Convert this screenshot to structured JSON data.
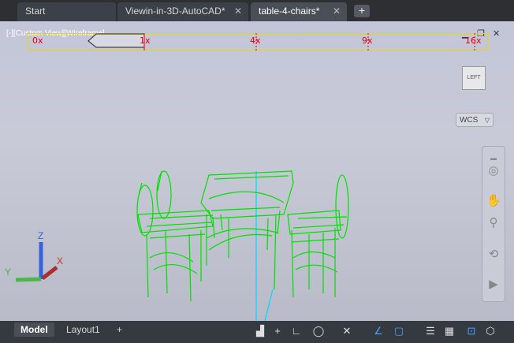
{
  "tabs": [
    {
      "label": "Start"
    },
    {
      "label": "Viewin-in-3D-AutoCAD*"
    },
    {
      "label": "table-4-chairs*"
    }
  ],
  "viewport": {
    "view_label": "[-][Custom View][Wireframe]",
    "wcs_label": "WCS",
    "viewcube_label": "LEFT"
  },
  "zoom_scale": {
    "labels": [
      "0x",
      "1x",
      "4x",
      "9x",
      "16x"
    ]
  },
  "layout_tabs": [
    {
      "label": "Model"
    },
    {
      "label": "Layout1"
    }
  ],
  "colors": {
    "wireframe": "#00e000",
    "zoom_labels": "#e00000",
    "zoom_border": "#e6d800"
  }
}
